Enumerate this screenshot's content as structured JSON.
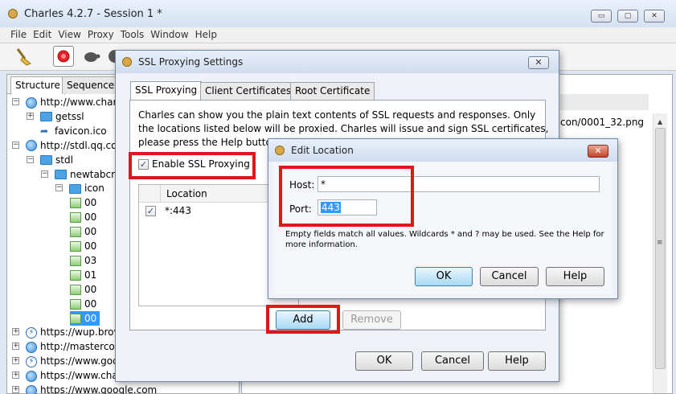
{
  "app": {
    "title": "Charles 4.2.7 - Session 1 *",
    "caption_minimize": "▭",
    "caption_maximize": "▢",
    "caption_close": "✕"
  },
  "menu": [
    "File",
    "Edit",
    "View",
    "Proxy",
    "Tools",
    "Window",
    "Help"
  ],
  "left_tabs": [
    "Structure",
    "Sequence"
  ],
  "tree": [
    {
      "label": "http://www.char",
      "icon": "globe-icon",
      "expander": "−"
    },
    {
      "label": "getssl",
      "icon": "folder-icon",
      "expander": "+"
    },
    {
      "label": "favicon.ico",
      "icon": "link-icon",
      "expander": ""
    },
    {
      "label": "http://stdl.qq.co",
      "icon": "globe-icon",
      "expander": "−"
    },
    {
      "label": "stdl",
      "icon": "folder-icon",
      "expander": "−"
    },
    {
      "label": "newtabcn",
      "icon": "folder-icon",
      "expander": "−"
    },
    {
      "label": "icon",
      "icon": "folder-icon",
      "expander": "−"
    },
    {
      "label": "00",
      "icon": "image-icon",
      "expander": ""
    },
    {
      "label": "00",
      "icon": "image-icon",
      "expander": ""
    },
    {
      "label": "00",
      "icon": "image-icon",
      "expander": ""
    },
    {
      "label": "00",
      "icon": "image-icon",
      "expander": ""
    },
    {
      "label": "03",
      "icon": "image-icon",
      "expander": ""
    },
    {
      "label": "01",
      "icon": "image-icon",
      "expander": ""
    },
    {
      "label": "00",
      "icon": "image-icon",
      "expander": ""
    },
    {
      "label": "00",
      "icon": "image-icon",
      "expander": ""
    },
    {
      "label": "00",
      "icon": "image-icon",
      "expander": "",
      "selected": true
    },
    {
      "label": "https://wup.brov",
      "icon": "bolt-icon",
      "expander": "+"
    },
    {
      "label": "http://mastercor",
      "icon": "globe-icon",
      "expander": "+"
    },
    {
      "label": "https://www.goo",
      "icon": "bolt-icon",
      "expander": "+"
    },
    {
      "label": "https://www.cha",
      "icon": "globe-icon",
      "expander": "+"
    },
    {
      "label": "https://www.google.com",
      "icon": "globe-icon",
      "expander": "+"
    }
  ],
  "right_pane": {
    "path_text": "con/0001_32.png"
  },
  "ssl_dialog": {
    "title": "SSL Proxying Settings",
    "close": "✕",
    "tabs": [
      "SSL Proxying",
      "Client Certificates",
      "Root Certificate"
    ],
    "description_lines": [
      "Charles can show you the plain text contents of SSL requests and responses. Only",
      "the locations listed below will be proxied. Charles will issue and sign SSL certificates,",
      "please press the Help butto"
    ],
    "enable_label": "Enable SSL Proxying",
    "enable_checked": "✓",
    "table_header": "Location",
    "rows": [
      {
        "checked": "✓",
        "location": "*:443"
      }
    ],
    "add_label": "Add",
    "remove_label": "Remove",
    "ok_label": "OK",
    "cancel_label": "Cancel",
    "help_label": "Help"
  },
  "edit_dialog": {
    "title": "Edit Location",
    "close": "✕",
    "host_label": "Host:",
    "host_value": "*",
    "port_label": "Port:",
    "port_value": "443",
    "note_lines": [
      "Empty fields match all values. Wildcards * and ? may be used. See the Help for",
      "more information."
    ],
    "ok_label": "OK",
    "cancel_label": "Cancel",
    "help_label": "Help"
  },
  "colors": {
    "highlight_box": "#e0161b",
    "selection": "#3399ff"
  }
}
